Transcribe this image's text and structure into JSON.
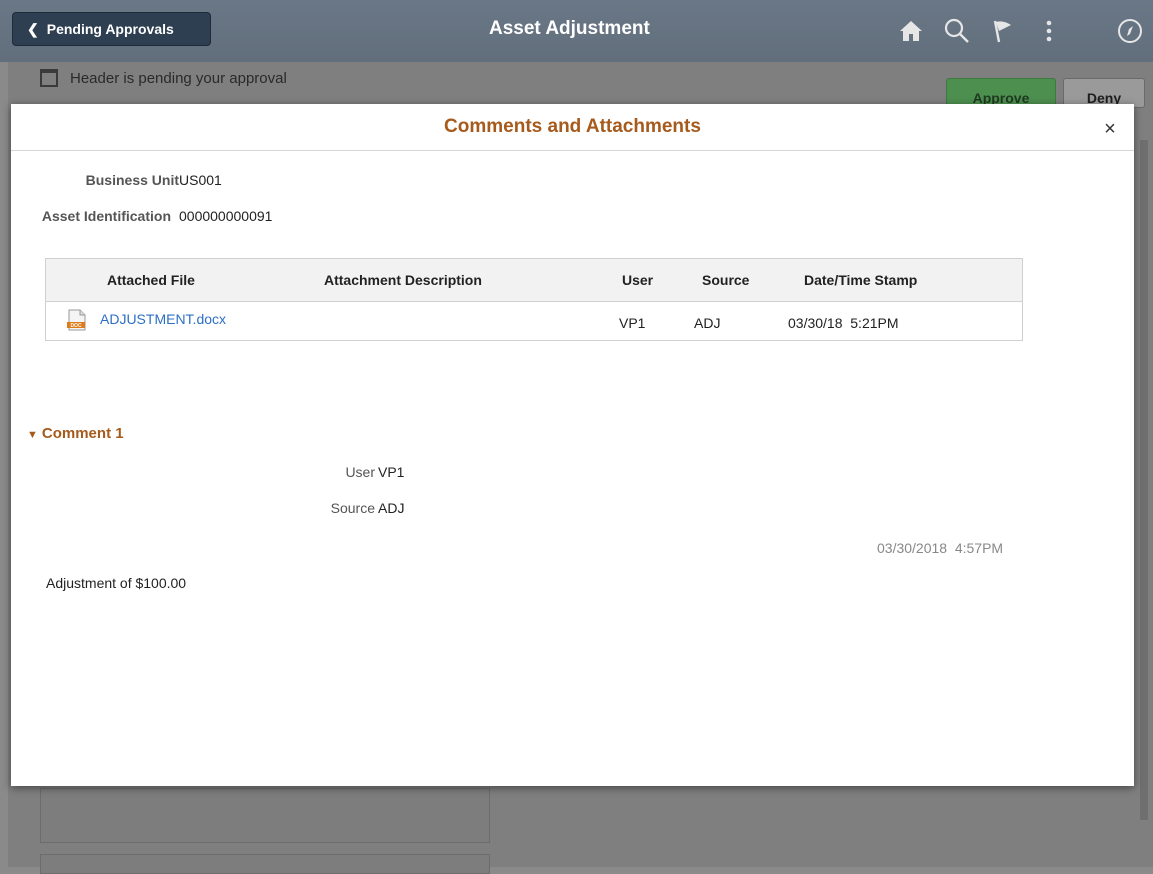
{
  "app": {
    "back_label": "Pending Approvals",
    "title": "Asset Adjustment"
  },
  "background": {
    "pending_text": "Header is pending your approval",
    "approve_label": "Approve",
    "deny_label": "Deny"
  },
  "modal": {
    "title": "Comments and Attachments",
    "close_label": "×",
    "fields": {
      "business_unit_label": "Business Unit",
      "business_unit_value": "US001",
      "asset_id_label": "Asset Identification",
      "asset_id_value": "000000000091"
    },
    "attachments": {
      "columns": [
        "Attached File",
        "Attachment Description",
        "User",
        "Source",
        "Date/Time Stamp"
      ],
      "rows": [
        {
          "file": "ADJUSTMENT.docx",
          "description": "",
          "user": "VP1",
          "source": "ADJ",
          "timestamp": "03/30/18  5:21PM"
        }
      ]
    },
    "comment": {
      "heading": "Comment 1",
      "user_label": "User",
      "user_value": "VP1",
      "source_label": "Source",
      "source_value": "ADJ",
      "timestamp": "03/30/2018  4:57PM",
      "text": "Adjustment of $100.00"
    }
  },
  "colors": {
    "accent": "#a65a1c",
    "link": "#2d6fc4",
    "approve_green": "#4d8f4f"
  },
  "icons": [
    "home-icon",
    "search-icon",
    "flag-icon",
    "more-vertical-icon",
    "navbar-compass-icon",
    "document-icon",
    "chevron-left-icon",
    "triangle-down-icon",
    "close-icon"
  ]
}
